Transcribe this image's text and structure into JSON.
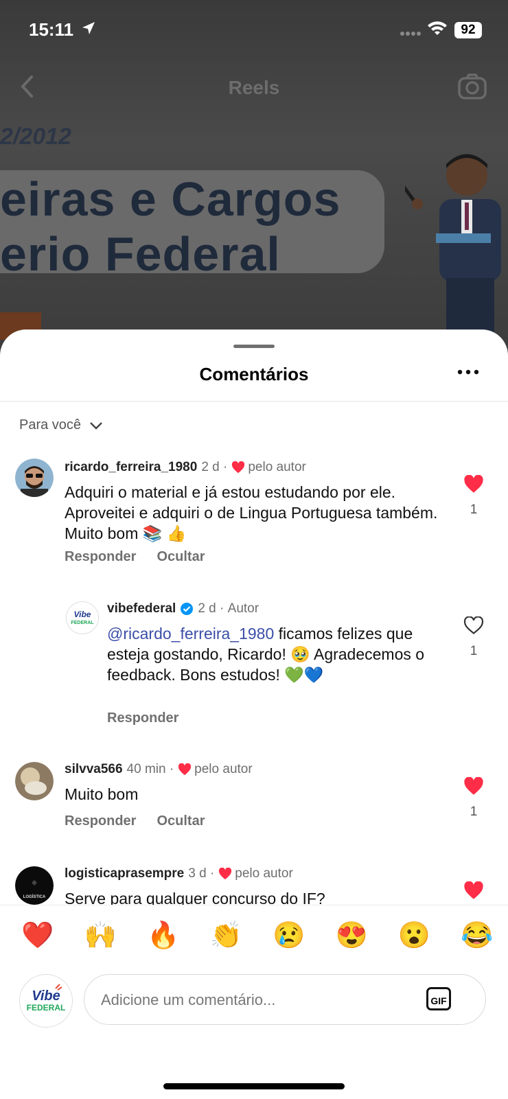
{
  "status": {
    "time": "15:11",
    "battery": "92"
  },
  "topbar": {
    "title": "Reels"
  },
  "video_bg": {
    "date_text": "2/2012",
    "line1": "eiras e Cargos",
    "line2": "erio Federal"
  },
  "sheet": {
    "title": "Comentários",
    "filter_label": "Para você"
  },
  "comments": [
    {
      "username": "ricardo_ferreira_1980",
      "time": "2 d",
      "liked_by_author": "pelo autor",
      "text": "Adquiri o material e já estou estudando por ele. Aproveitei e adquiri o de Lingua Portuguesa também. Muito bom 📚 👍",
      "reply_label": "Responder",
      "hide_label": "Ocultar",
      "likes": "1",
      "liked": true
    },
    {
      "username": "vibefederal",
      "time": "2 d",
      "author_label": "Autor",
      "mention": "@ricardo_ferreira_1980",
      "text": " ficamos felizes que esteja gostando, Ricardo! 🥹 Agradecemos o feedback. Bons estudos! 💚💙",
      "reply_label": "Responder",
      "likes": "1",
      "liked": false
    },
    {
      "username": "silvva566",
      "time": "40 min",
      "liked_by_author": "pelo autor",
      "text": "Muito bom",
      "reply_label": "Responder",
      "hide_label": "Ocultar",
      "likes": "1",
      "liked": true
    },
    {
      "username": "logisticaprasempre",
      "time": "3 d",
      "liked_by_author": "pelo autor",
      "text": "Serve  para qualquer concurso do IF?",
      "liked": true,
      "avatar_text": "LOGÍSTICA"
    }
  ],
  "reactions": [
    "❤️",
    "🙌",
    "🔥",
    "👏",
    "😢",
    "😍",
    "😮",
    "😂"
  ],
  "composer": {
    "placeholder": "Adicione um comentário...",
    "gif_label": "GIF"
  },
  "brand": {
    "logo_line1": "Vibe",
    "logo_line2": "FEDERAL"
  },
  "colors": {
    "heart": "#ff2d47",
    "verified": "#0095f6",
    "mention": "#3b4ea8"
  }
}
